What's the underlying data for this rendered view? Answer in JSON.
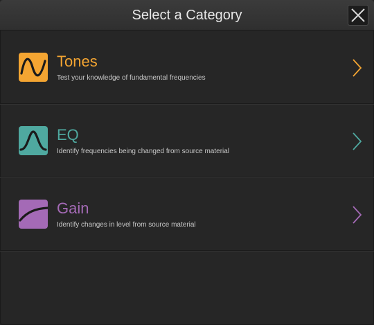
{
  "header": {
    "title": "Select a Category",
    "close_icon": "close-x-icon"
  },
  "categories": [
    {
      "title": "Tones",
      "description": "Test your knowledge of fundamental frequencies",
      "color": "#f4a532",
      "icon": "sine-wave-icon"
    },
    {
      "title": "EQ",
      "description": "Identify frequencies being changed from source material",
      "color": "#4fa9a0",
      "icon": "bell-curve-icon"
    },
    {
      "title": "Gain",
      "description": "Identify changes in level from source material",
      "color": "#a46ab6",
      "icon": "gain-curve-icon"
    }
  ]
}
